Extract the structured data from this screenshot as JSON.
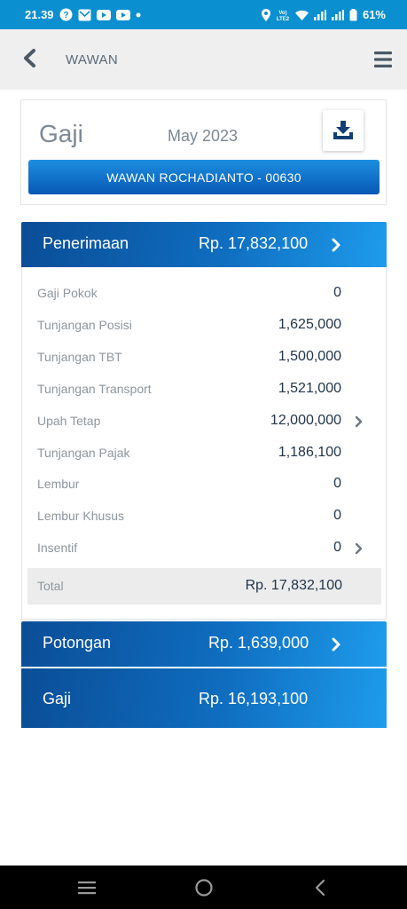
{
  "status_bar": {
    "time": "21.39",
    "battery": "61%",
    "network_label": "Vo) LTE2"
  },
  "app_bar": {
    "title": "WAWAN",
    "back_icon": "chevron-left-icon",
    "menu_icon": "hamburger-icon"
  },
  "header": {
    "title": "Gaji",
    "period": "May 2023",
    "download_icon": "download-icon",
    "employee": "WAWAN ROCHADIANTO - 00630"
  },
  "penerimaan": {
    "label": "Penerimaan",
    "amount": "Rp. 17,832,100",
    "items": [
      {
        "label": "Gaji Pokok",
        "value": "0",
        "expandable": false
      },
      {
        "label": "Tunjangan Posisi",
        "value": "1,625,000",
        "expandable": false
      },
      {
        "label": "Tunjangan TBT",
        "value": "1,500,000",
        "expandable": false
      },
      {
        "label": "Tunjangan Transport",
        "value": "1,521,000",
        "expandable": false
      },
      {
        "label": "Upah Tetap",
        "value": "12,000,000",
        "expandable": true
      },
      {
        "label": "Tunjangan Pajak",
        "value": "1,186,100",
        "expandable": false
      },
      {
        "label": "Lembur",
        "value": "0",
        "expandable": false
      },
      {
        "label": "Lembur Khusus",
        "value": "0",
        "expandable": false
      },
      {
        "label": "Insentif",
        "value": "0",
        "expandable": true
      }
    ],
    "total_label": "Total",
    "total_value": "Rp. 17,832,100"
  },
  "potongan": {
    "label": "Potongan",
    "amount": "Rp. 1,639,000"
  },
  "gaji_total": {
    "label": "Gaji",
    "amount": "Rp. 16,193,100"
  },
  "colors": {
    "status_bar": "#0a8fd0",
    "section_dark": "#0a4d96",
    "section_light": "#1e9cec",
    "value_text": "#22344a"
  }
}
